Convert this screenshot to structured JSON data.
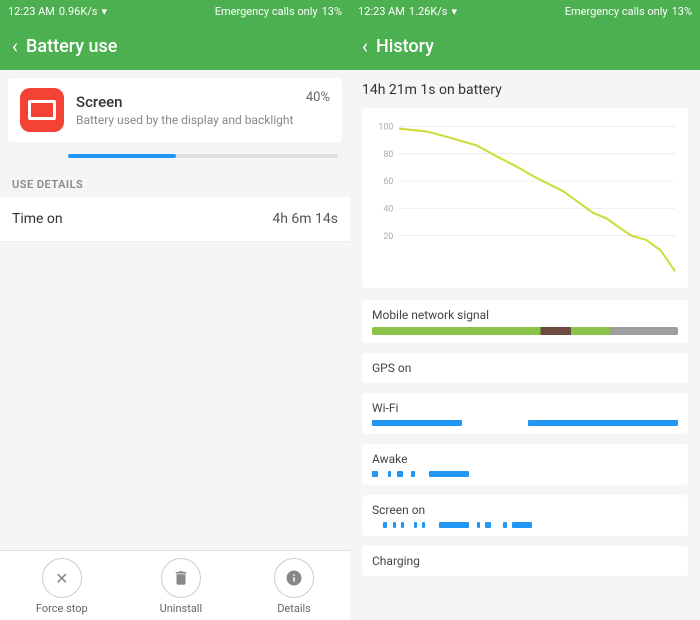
{
  "left": {
    "statusBar": {
      "time": "12:23 AM",
      "network": "0.96K/s",
      "wifi": "wifi",
      "emergency": "Emergency calls only",
      "battery": "13%"
    },
    "topBar": {
      "title": "Battery use",
      "backArrow": "‹"
    },
    "appInfo": {
      "name": "Screen",
      "description": "Battery used by the display and backlight",
      "percent": "40%",
      "progressWidth": "40"
    },
    "useDetailsHeader": "USE DETAILS",
    "details": [
      {
        "label": "Time on",
        "value": "4h 6m 14s"
      }
    ],
    "actions": [
      {
        "icon": "✕",
        "label": "Force stop"
      },
      {
        "icon": "🗑",
        "label": "Uninstall"
      },
      {
        "icon": "ℹ",
        "label": "Details"
      }
    ]
  },
  "right": {
    "statusBar": {
      "time": "12:23 AM",
      "network": "1.26K/s",
      "wifi": "wifi",
      "emergency": "Emergency calls only",
      "battery": "13%"
    },
    "topBar": {
      "title": "History",
      "backArrow": "‹"
    },
    "batteryTime": "14h 21m 1s on battery",
    "chart": {
      "yLabels": [
        "100",
        "80",
        "60",
        "40",
        "20"
      ],
      "accentColor": "#cddc39"
    },
    "sections": [
      {
        "key": "mobile_signal",
        "label": "Mobile network signal"
      },
      {
        "key": "gps",
        "label": "GPS on"
      },
      {
        "key": "wifi",
        "label": "Wi-Fi"
      },
      {
        "key": "awake",
        "label": "Awake"
      },
      {
        "key": "screen_on",
        "label": "Screen on"
      },
      {
        "key": "charging",
        "label": "Charging"
      }
    ]
  }
}
